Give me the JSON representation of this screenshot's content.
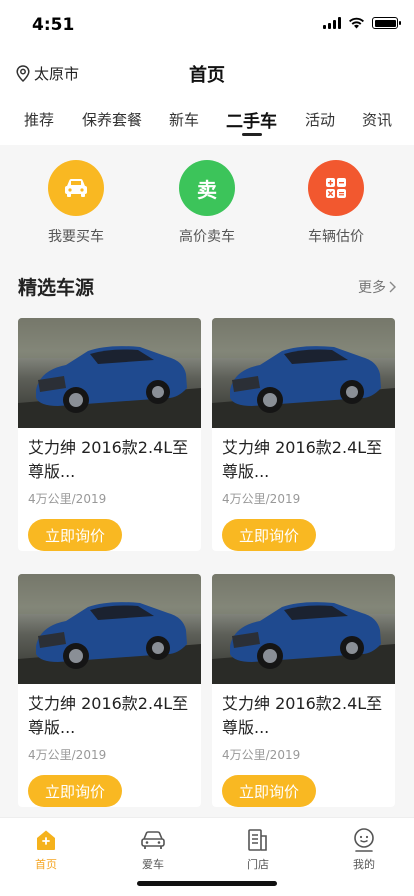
{
  "status": {
    "time": "4:51"
  },
  "header": {
    "location": "太原市",
    "title": "首页",
    "location_icon": "location-pin-icon"
  },
  "tabs": [
    {
      "label": "推荐"
    },
    {
      "label": "保养套餐"
    },
    {
      "label": "新车"
    },
    {
      "label": "二手车",
      "active": true
    },
    {
      "label": "活动"
    },
    {
      "label": "资讯"
    }
  ],
  "quick_actions": [
    {
      "label": "我要买车",
      "icon": "car-icon",
      "color": "#f9b822"
    },
    {
      "label": "高价卖车",
      "icon_text": "卖",
      "color": "#3cc45a"
    },
    {
      "label": "车辆估价",
      "icon": "calculator-icon",
      "color": "#f2582f"
    }
  ],
  "section": {
    "title": "精选车源",
    "more": "更多"
  },
  "cars": [
    {
      "name": "艾力绅 2016款2.4L至尊版...",
      "meta": "4万公里/2019",
      "button": "立即询价"
    },
    {
      "name": "艾力绅 2016款2.4L至尊版...",
      "meta": "4万公里/2019",
      "button": "立即询价"
    },
    {
      "name": "艾力绅 2016款2.4L至尊版...",
      "meta": "4万公里/2019",
      "button": "立即询价"
    },
    {
      "name": "艾力绅 2016款2.4L至尊版...",
      "meta": "4万公里/2019",
      "button": "立即询价"
    }
  ],
  "bottom_nav": [
    {
      "label": "首页",
      "icon": "home-icon",
      "active": true
    },
    {
      "label": "爱车",
      "icon": "car-icon"
    },
    {
      "label": "门店",
      "icon": "store-icon"
    },
    {
      "label": "我的",
      "icon": "profile-icon"
    }
  ],
  "colors": {
    "accent": "#f9b822",
    "active_nav": "#f5a623"
  }
}
